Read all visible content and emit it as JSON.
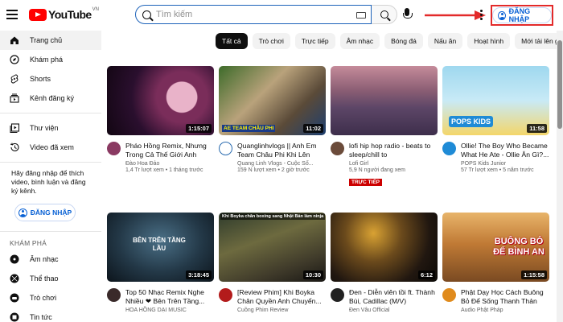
{
  "header": {
    "logo_text": "YouTube",
    "region": "VN",
    "search_placeholder": "Tìm kiếm",
    "signin_label": "ĐĂNG NHẬP"
  },
  "sidebar": {
    "items": [
      {
        "label": "Trang chủ",
        "icon": "home-icon"
      },
      {
        "label": "Khám phá",
        "icon": "explore-icon"
      },
      {
        "label": "Shorts",
        "icon": "shorts-icon"
      },
      {
        "label": "Kênh đăng ký",
        "icon": "subscriptions-icon"
      },
      {
        "label": "Thư viện",
        "icon": "library-icon"
      },
      {
        "label": "Video đã xem",
        "icon": "history-icon"
      }
    ],
    "note": "Hãy đăng nhập để thích video, bình luận và đăng ký kênh.",
    "signin_label": "ĐĂNG NHẬP",
    "explore_heading": "KHÁM PHÁ",
    "explore_items": [
      {
        "label": "Âm nhạc",
        "icon": "music-icon"
      },
      {
        "label": "Thể thao",
        "icon": "sports-icon"
      },
      {
        "label": "Trò chơi",
        "icon": "gaming-icon"
      },
      {
        "label": "Tin tức",
        "icon": "news-icon"
      }
    ]
  },
  "chips": [
    "Tất cả",
    "Trò chơi",
    "Trực tiếp",
    "Âm nhạc",
    "Bóng đá",
    "Nấu ăn",
    "Hoạt hình",
    "Mới tải lên gần đây"
  ],
  "videos": [
    {
      "title": "Pháo Hồng Remix, Nhưng Trong Cả Thế Giới Anh Mất...",
      "channel": "Đào Hoa Đảo",
      "views": "1,4 Tr lượt xem • 1 tháng trước",
      "duration": "1:15:07",
      "thumb_text": "",
      "live": ""
    },
    {
      "title": "Quanglinhvlogs || Anh Em Team Châu Phi Khi Lên Đồ...",
      "channel": "Quang Linh Vlogs - Cuộc Số...",
      "views": "159 N lượt xem • 2 giờ trước",
      "duration": "11:02",
      "thumb_text": "AE TEAM CHÂU PHI",
      "live": ""
    },
    {
      "title": "lofi hip hop radio - beats to sleep/chill to",
      "channel": "Lofi Girl",
      "views": "5,9 N người đang xem",
      "duration": "",
      "thumb_text": "",
      "live": "TRỰC TIẾP"
    },
    {
      "title": "Ollie! The Boy Who Became What He Ate - Ollie Ăn Gì?...",
      "channel": "POPS Kids Junior",
      "views": "57 Tr lượt xem • 5 năm trước",
      "duration": "11:58",
      "thumb_text": "POPS KIDS",
      "live": ""
    },
    {
      "title": "Top 50 Nhạc Remix Nghe Nhiều ❤ Bên Trên Tầng...",
      "channel": "HOA HỒNG DẠI MUSIC",
      "views": "",
      "duration": "3:18:45",
      "thumb_text": "BÊN TRÊN TẦNG LẦU",
      "live": ""
    },
    {
      "title": "[Review Phim] Khi Boyka Chân Quyền Anh Chuyển...",
      "channel": "Cuồng Phim Review",
      "views": "",
      "duration": "10:30",
      "thumb_text": "Khi Boyka chân boxing sang Nhật Bản làm ninja",
      "live": ""
    },
    {
      "title": "Đen - Diễn viên tồi ft. Thành Bùi, Cadillac (M/V)",
      "channel": "Đen Vâu Official",
      "views": "",
      "duration": "6:12",
      "thumb_text": "",
      "live": ""
    },
    {
      "title": "Phật Dạy Học Cách Buông Bỏ Để Sống Thanh Thản Nh...",
      "channel": "Audio Phật Pháp",
      "views": "",
      "duration": "1:15:58",
      "thumb_text": "BUÔNG BỎ ĐỂ BÌNH AN",
      "live": ""
    }
  ],
  "colors": {
    "brand_red": "#ff0000",
    "link_blue": "#065fd4",
    "highlight_box": "#e32a2a"
  }
}
